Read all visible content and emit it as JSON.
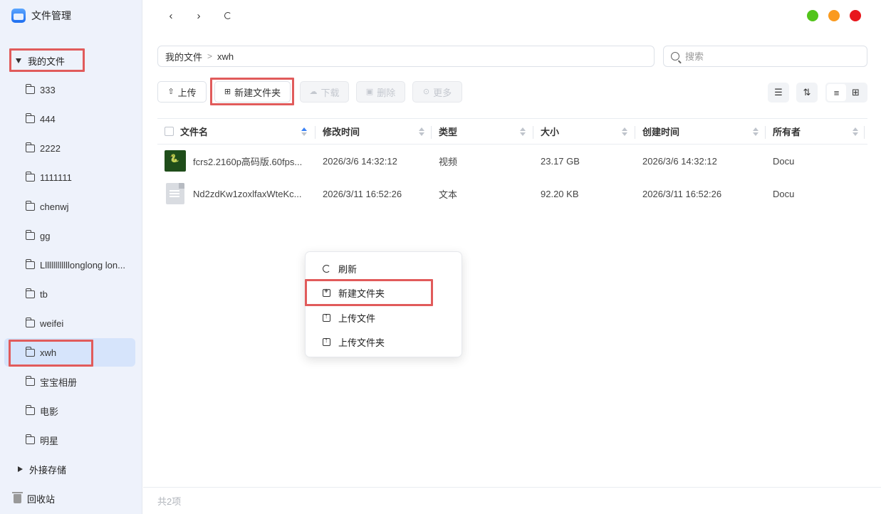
{
  "app": {
    "title": "文件管理",
    "icon": "file-manager-logo"
  },
  "sidebar": {
    "root_label": "我的文件",
    "items": [
      {
        "label": "333"
      },
      {
        "label": "444"
      },
      {
        "label": "2222"
      },
      {
        "label": "1111111"
      },
      {
        "label": "chenwj"
      },
      {
        "label": "gg"
      },
      {
        "label": "Lllllllllllllonglong lon..."
      },
      {
        "label": "tb"
      },
      {
        "label": "weifei"
      },
      {
        "label": "xwh",
        "active": true
      },
      {
        "label": "宝宝相册"
      },
      {
        "label": "电影"
      },
      {
        "label": "明星"
      }
    ],
    "external_storage": "外接存储",
    "trash": "回收站"
  },
  "nav": {
    "back": "‹",
    "forward": "›"
  },
  "window_controls": {
    "green": "#52c41a",
    "orange": "#fa9a1e",
    "red": "#e8161c"
  },
  "breadcrumb": {
    "root": "我的文件",
    "current": "xwh"
  },
  "search": {
    "placeholder": "搜索",
    "value": ""
  },
  "toolbar": {
    "upload": "上传",
    "new_folder": "新建文件夹",
    "download": "下载",
    "delete": "删除",
    "more": "更多"
  },
  "table": {
    "columns": [
      "文件名",
      "修改时间",
      "类型",
      "大小",
      "创建时间",
      "所有者"
    ],
    "rows": [
      {
        "name": "fcrs2.2160p高码版.60fps...",
        "modified": "2026/3/6 14:32:12",
        "type": "视频",
        "size": "23.17 GB",
        "created": "2026/3/6 14:32:12",
        "owner": "Docu",
        "icon": "video-thumbnail"
      },
      {
        "name": "Nd2zdKw1zoxlfaxWteKc...",
        "modified": "2026/3/11 16:52:26",
        "type": "文本",
        "size": "92.20 KB",
        "created": "2026/3/11 16:52:26",
        "owner": "Docu",
        "icon": "document-icon"
      }
    ]
  },
  "context_menu": {
    "items": [
      {
        "label": "刷新",
        "icon": "refresh-icon"
      },
      {
        "label": "新建文件夹",
        "icon": "new-folder-icon"
      },
      {
        "label": "上传文件",
        "icon": "upload-file-icon"
      },
      {
        "label": "上传文件夹",
        "icon": "upload-folder-icon"
      }
    ]
  },
  "footer": {
    "count": "共2项"
  },
  "highlight_color": "#e15b5b"
}
